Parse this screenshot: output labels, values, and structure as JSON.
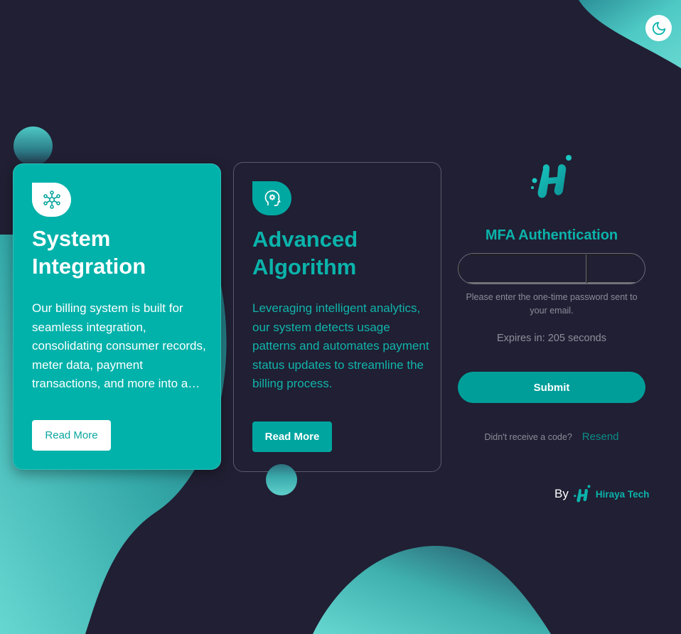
{
  "theme_toggle": {
    "icon": "moon-icon"
  },
  "cards": [
    {
      "icon": "network-hub-icon",
      "title": "System Integration",
      "text": "Our billing system is built for seamless integration, consolidating consumer records, meter data, payment transactions, and more into a single platform.",
      "button": "Read More"
    },
    {
      "icon": "mind-gear-icon",
      "title": "Advanced Algorithm",
      "text": "Leveraging intelligent analytics, our system detects usage patterns and automates payment status updates to streamline the billing process.",
      "button": "Read More"
    }
  ],
  "auth": {
    "title": "MFA Authentication",
    "otp_length": 6,
    "hint": "Please enter the one-time password sent to your email.",
    "expires": "Expires in: 205 seconds",
    "submit": "Submit",
    "resend_prompt": "Didn't receive a code?",
    "resend_link": "Resend"
  },
  "footer": {
    "by_label": "By",
    "brand": "Hiraya Tech"
  },
  "colors": {
    "background": "#211f33",
    "accent": "#00b2aa",
    "accent_dark": "#009e99"
  }
}
